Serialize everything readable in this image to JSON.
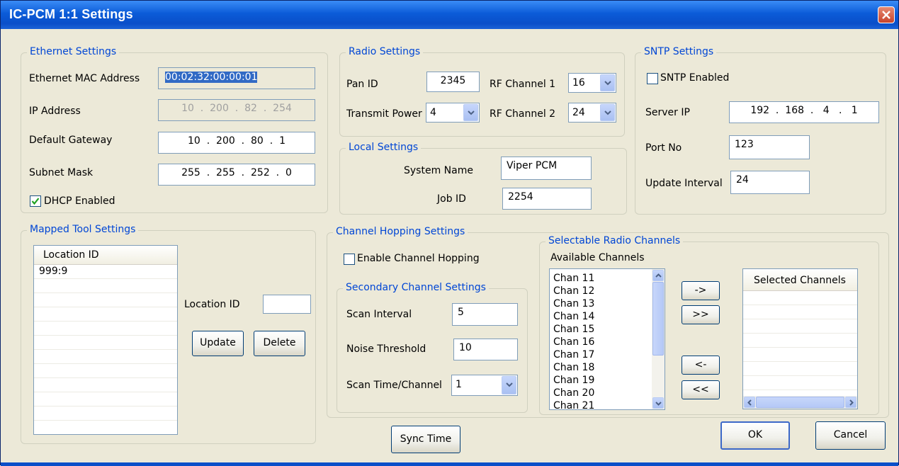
{
  "window": {
    "title": "IC-PCM 1:1 Settings"
  },
  "ethernet": {
    "legend": "Ethernet Settings",
    "mac_label": "Ethernet MAC Address",
    "mac_value": "00:02:32:00:00:01",
    "ip_label": "IP Address",
    "ip_value": "10  .  200  .  82  .  254",
    "gateway_label": "Default Gateway",
    "gateway_value": "10  .  200  .  80  .  1",
    "subnet_label": "Subnet Mask",
    "subnet_value": "255  .  255  .  252  .  0",
    "dhcp_label": "DHCP Enabled",
    "dhcp_checked": true
  },
  "radio": {
    "legend": "Radio Settings",
    "pan_label": "Pan ID",
    "pan_value": "2345",
    "rf1_label": "RF Channel 1",
    "rf1_value": "16",
    "power_label": "Transmit Power",
    "power_value": "4",
    "rf2_label": "RF Channel 2",
    "rf2_value": "24"
  },
  "sntp": {
    "legend": "SNTP Settings",
    "enabled_label": "SNTP Enabled",
    "enabled_checked": false,
    "server_label": "Server IP",
    "server_value": "192  .  168  .   4   .   1",
    "port_label": "Port No",
    "port_value": "123",
    "interval_label": "Update Interval",
    "interval_value": "24"
  },
  "local": {
    "legend": "Local Settings",
    "system_label": "System Name",
    "system_value": "Viper PCM",
    "job_label": "Job ID",
    "job_value": "2254"
  },
  "mapped": {
    "legend": "Mapped Tool Settings",
    "column_header": "Location ID",
    "rows": [
      "999:9"
    ],
    "location_label": "Location ID",
    "location_value": "",
    "update_label": "Update",
    "delete_label": "Delete"
  },
  "hopping": {
    "legend": "Channel Hopping Settings",
    "enable_label": "Enable Channel Hopping",
    "enable_checked": false,
    "secondary": {
      "legend": "Secondary Channel Settings",
      "scan_interval_label": "Scan Interval",
      "scan_interval_value": "5",
      "noise_label": "Noise Threshold",
      "noise_value": "10",
      "scan_time_label": "Scan Time/Channel",
      "scan_time_value": "1"
    },
    "selectable": {
      "legend": "Selectable Radio Channels",
      "available_label": "Available Channels",
      "available": [
        "Chan 11",
        "Chan 12",
        "Chan 13",
        "Chan 14",
        "Chan 15",
        "Chan 16",
        "Chan 17",
        "Chan 18",
        "Chan 19",
        "Chan 20",
        "Chan 21"
      ],
      "selected_header": "Selected Channels",
      "add_one": "->",
      "add_all": ">>",
      "remove_one": "<-",
      "remove_all": "<<"
    }
  },
  "buttons": {
    "sync_time": "Sync Time",
    "ok": "OK",
    "cancel": "Cancel"
  },
  "colors": {
    "titlebar": "#0a4fc9",
    "legend_text": "#0046d5",
    "selection": "#316ac5",
    "dialog_bg": "#ece9d8"
  }
}
